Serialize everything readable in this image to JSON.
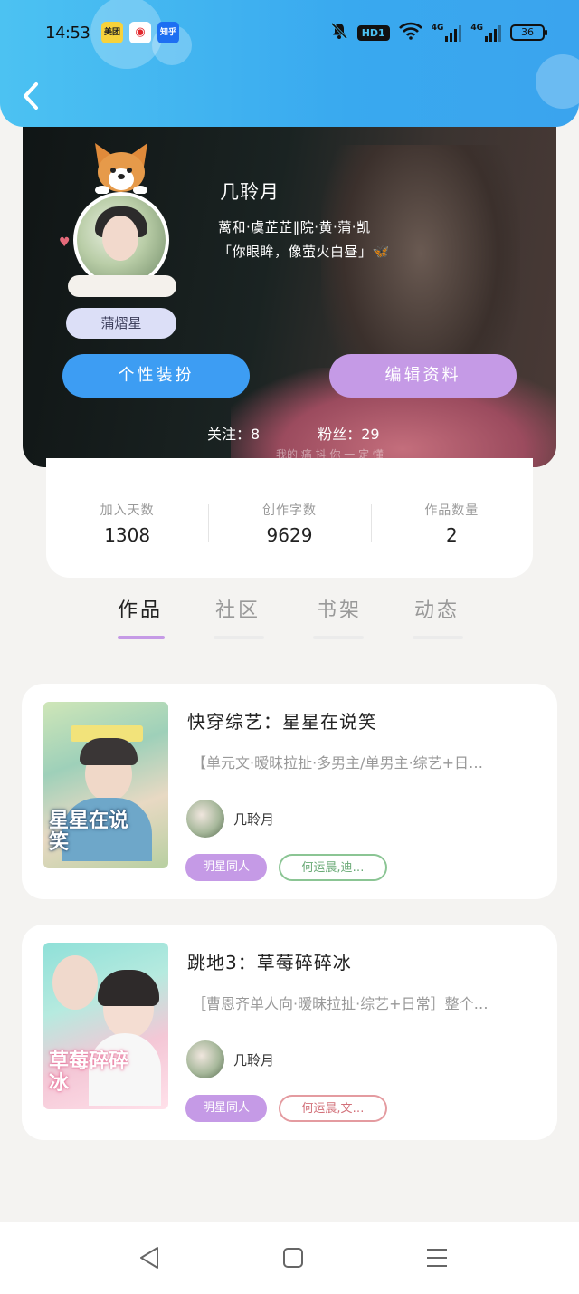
{
  "status_bar": {
    "time": "14:53",
    "app_badges": [
      "美团",
      "◉",
      "知乎"
    ],
    "network_hd": "HD1",
    "signal_1": "4G",
    "signal_2": "4G",
    "battery": "36"
  },
  "profile": {
    "name": "几聆月",
    "bio_line1": "蓠和·虞芷芷‖院·黄·蒲·凯",
    "bio_line2": "「你眼眸，像萤火白昼」🦋",
    "nickname_tag": "蒲熠星",
    "dressup_button": "个性装扮",
    "edit_button": "编辑资料",
    "following": "关注：8",
    "followers": "粉丝：29",
    "banner_caption": "我的 痛 抖    你 一 定 懂"
  },
  "stats": [
    {
      "label": "加入天数",
      "value": "1308"
    },
    {
      "label": "创作字数",
      "value": "9629"
    },
    {
      "label": "作品数量",
      "value": "2"
    }
  ],
  "tabs": [
    {
      "label": "作品",
      "active": true
    },
    {
      "label": "社区",
      "active": false
    },
    {
      "label": "书架",
      "active": false
    },
    {
      "label": "动态",
      "active": false
    }
  ],
  "works": [
    {
      "title": "快穿综艺：星星在说笑",
      "description": "【单元文·暧昧拉扯·多男主/单男主·综艺+日…",
      "author": "几聆月",
      "cover_text": "星星在说笑",
      "category_tag": "明星同人",
      "character_tag": "何运晨,迪…"
    },
    {
      "title": "跳地3：草莓碎碎冰",
      "description": "［曹恩齐单人向·暧昧拉扯·综艺+日常］整个…",
      "author": "几聆月",
      "cover_text": "草莓碎碎冰",
      "category_tag": "明星同人",
      "character_tag": "何运晨,文…"
    }
  ],
  "colors": {
    "header_blue": "#3aa9ef",
    "accent_purple": "#c59ae6",
    "accent_blue": "#3d9df3",
    "tag_green": "#8bc594",
    "tag_red": "#e49ba0"
  },
  "icons": {
    "back": "chevron-left-icon",
    "nav_back": "triangle-back-icon",
    "nav_home": "square-home-icon",
    "nav_menu": "menu-icon"
  }
}
